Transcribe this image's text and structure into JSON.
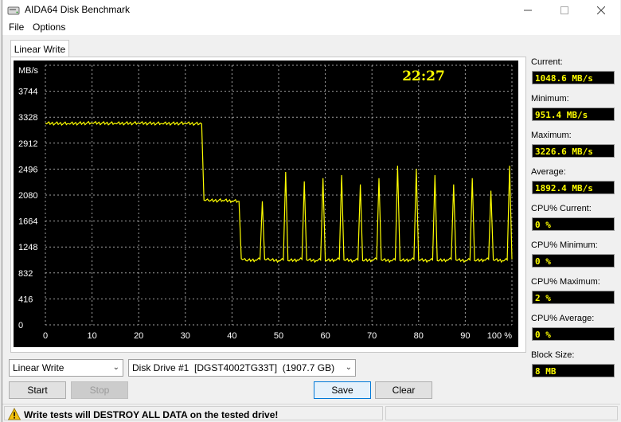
{
  "window": {
    "title": "AIDA64 Disk Benchmark"
  },
  "menu": {
    "file": "File",
    "options": "Options"
  },
  "tab": {
    "label": "Linear Write"
  },
  "graph": {
    "unit": "MB/s",
    "timer": "22:27",
    "y_ticks": [
      "3744",
      "3328",
      "2912",
      "2496",
      "2080",
      "1664",
      "1248",
      "832",
      "416",
      "0"
    ],
    "x_ticks": [
      "0",
      "10",
      "20",
      "30",
      "40",
      "50",
      "60",
      "70",
      "80",
      "90",
      "100 %"
    ],
    "line_color": "#ffff00",
    "grid_color": "#a0a0a0"
  },
  "chart_data": {
    "type": "line",
    "title": "",
    "xlabel": "",
    "ylabel": "MB/s",
    "xlim": [
      0,
      100
    ],
    "ylim": [
      0,
      4160
    ],
    "grid": true,
    "series": [
      {
        "values_x": [
          0,
          5,
          10,
          15,
          20,
          25,
          30,
          33.5,
          34,
          35,
          38,
          40,
          41.5,
          42,
          43,
          45,
          46,
          46.5,
          47,
          48,
          50,
          51,
          51.5,
          52,
          54,
          55,
          55.5,
          56,
          58,
          59,
          59.5,
          60,
          62,
          63,
          63.5,
          64,
          66,
          67,
          67.5,
          68,
          70,
          71,
          71.5,
          72,
          74,
          75,
          75.5,
          76,
          78,
          79,
          79.5,
          80,
          82,
          83,
          83.5,
          84,
          86,
          87,
          87.5,
          88,
          90,
          91,
          91.5,
          92,
          94,
          95,
          95.5,
          96,
          98,
          99,
          99.5,
          100
        ],
        "values_y": [
          3230,
          3225,
          3235,
          3228,
          3232,
          3226,
          3230,
          3220,
          2000,
          1990,
          1995,
          1985,
          1980,
          1060,
          1030,
          1040,
          1050,
          1980,
          1050,
          1040,
          1030,
          1040,
          2450,
          1030,
          1040,
          1050,
          2300,
          1040,
          1030,
          1040,
          2350,
          1030,
          1040,
          1050,
          2400,
          1040,
          1030,
          1040,
          2250,
          1030,
          1040,
          1050,
          2350,
          1040,
          1030,
          1040,
          2550,
          1030,
          1040,
          1050,
          2500,
          1040,
          1030,
          1040,
          2400,
          1030,
          1040,
          1050,
          2250,
          1040,
          1030,
          1040,
          2350,
          1030,
          1040,
          1050,
          2150,
          1040,
          1030,
          1040,
          2550,
          1048.6
        ]
      }
    ]
  },
  "stats": [
    {
      "label": "Current:",
      "value": "1048.6 MB/s"
    },
    {
      "label": "Minimum:",
      "value": "951.4 MB/s"
    },
    {
      "label": "Maximum:",
      "value": "3226.6 MB/s"
    },
    {
      "label": "Average:",
      "value": "1892.4 MB/s"
    },
    {
      "label": "CPU% Current:",
      "value": "0 %"
    },
    {
      "label": "CPU% Minimum:",
      "value": "0 %"
    },
    {
      "label": "CPU% Maximum:",
      "value": "2 %"
    },
    {
      "label": "CPU% Average:",
      "value": "0 %"
    },
    {
      "label": "Block Size:",
      "value": "8 MB"
    }
  ],
  "controls": {
    "test_select": "Linear Write",
    "drive_select": "Disk Drive #1  [DGST4002TG33T]  (1907.7 GB)",
    "start": "Start",
    "stop": "Stop",
    "save": "Save",
    "clear": "Clear"
  },
  "status": {
    "warning": "Write tests will DESTROY ALL DATA on the tested drive!"
  }
}
